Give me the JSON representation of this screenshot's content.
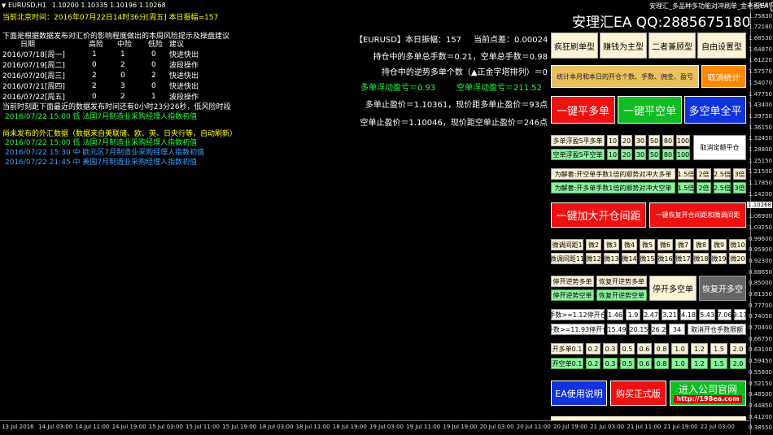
{
  "chart_header": {
    "symbol_tf": "EURUSD,H1",
    "prices": "1.10200 1.10335 1.10196 1.10268"
  },
  "ea_badge": "安理汇_多品种多功能对冲刷单_金老板EA",
  "beijing_time": "当前北京时间：2016年07月22日14时36分[周五] 本日振幅=157",
  "risk_title": "下面是根据数据发布对汇价的影响程度做出的本周风险提示及操盘建议",
  "risk_headers": [
    "日期",
    "高险",
    "中险",
    "低险",
    "建议"
  ],
  "risk_rows": [
    [
      "2016/07/18[周一]",
      "1",
      "1",
      "0",
      "快进快出"
    ],
    [
      "2016/07/19[周二]",
      "0",
      "2",
      "0",
      "波段操作"
    ],
    [
      "2016/07/20[周三]",
      "2",
      "0",
      "2",
      "快进快出"
    ],
    [
      "2016/07/21[周四]",
      "2",
      "3",
      "0",
      "快进快出"
    ],
    [
      "2016/07/22[周五]",
      "0",
      "2",
      "1",
      "波段操作"
    ]
  ],
  "countdown": "当前时刻距下面最近的数据发布时间还有0小时23分26秒，低风险时段",
  "next_release": "2016/07/22 15:00 低 法国7月制造业采购经理人指数初值",
  "upcoming_title": "尚未发布的外汇数据（数据来自美联储、欧、英、日央行等，自动刷新）",
  "upcoming": [
    "2016/07/22 15:00 低 法国7月制造业采购经理人指数初值",
    "2016/07/22 15:30 中 欧元区7月制造业采购经理人指数初值",
    "2016/07/22 21:45 中 美国7月制造业采购经理人指数初值"
  ],
  "brand": "安理汇EA QQ:2885675180",
  "stats": {
    "amplitude": "【EURUSD】本日振幅：157",
    "spread": "当前点差：0.00024",
    "lots": "持仓中的多单总手数＝0.21，空单总手数＝0.98",
    "reverse": "持仓中的逆势多单个数（▲正金字塔排列）＝0",
    "buy_float": "多单浮动盈亏＝0.93",
    "sell_float": "空单浮动盈亏＝211.52",
    "buy_tp": "多单止盈价＝1.10361，现价距多单止盈价＝93点",
    "sell_tp": "空单止盈价＝1.10046，现价距空单止盈价＝246点"
  },
  "mode_buttons": [
    "疯狂刷单型",
    "赚钱为主型",
    "二者兼顾型",
    "自由设置型"
  ],
  "stat_button": "统计本月和本日的开仓个数、手数、佣金、盈亏",
  "cancel_stat": "取消统计",
  "close_buy": "一键平多单",
  "close_sell": "一键平空单",
  "close_all": "多空单全平",
  "buy_float_close_label": "多单浮盈5平多单",
  "sell_float_close_label": "空单浮盈5平空单",
  "float_values": [
    "10",
    "20",
    "30",
    "50",
    "80",
    "100"
  ],
  "cancel_float": "取消定额平仓",
  "unlock_buy": "为解套:开空单手数1倍的顺势对冲大多单",
  "unlock_sell": "为解套:开多单手数1倍的顺势对冲大空单",
  "multipliers": [
    "1.5倍",
    "2倍",
    "2.5倍",
    "3倍"
  ],
  "widen_gap": "一键加大开仓间距",
  "restore_gap": "一键恢复开仓间距和微调间距",
  "adjust_row1": [
    "微调间距1",
    "微2",
    "微3",
    "微4",
    "微5",
    "微6",
    "微7",
    "微8",
    "微9",
    "微10"
  ],
  "adjust_row2": [
    "微调间距11",
    "微12",
    "微13",
    "微14",
    "微15",
    "微16",
    "微17",
    "微18",
    "微19",
    "微20"
  ],
  "stop_reverse_buy": "停开逆势多单",
  "resume_reverse_buy": "恢复开逆势多单",
  "stop_reverse_sell": "停开逆势空单",
  "resume_reverse_sell": "恢复开逆势空单",
  "stop_hedge": "停开多空单",
  "resume_hedge": "恢复开多空",
  "lots_row1_label": "手数>=1.12停开仓",
  "lots_row1_values": [
    "1.46",
    "1.9",
    "2.47",
    "3.21",
    "4.18",
    "5.43",
    "7.06",
    "9.17"
  ],
  "lots_row2_label": "手数>=11.93停开仓",
  "lots_row2_values": [
    "15.49",
    "20.15",
    "26.2",
    "34"
  ],
  "cancel_lots_limit": "取消开仓手数限额",
  "open_buy_label": "开多单0.1",
  "open_sell_label": "开空单0.1",
  "open_values": [
    "0.2",
    "0.3",
    "0.5",
    "0.6",
    "0.8",
    "1.0",
    "1.2",
    "1.5",
    "2.0"
  ],
  "help_button": "EA使用说明",
  "buy_button": "购买正式版",
  "website_button": "进入公司官网",
  "website_url": "http://198ea.com",
  "price_ticks": [
    "1.79480",
    "1.75830",
    "1.72180",
    "1.68530",
    "1.64870",
    "1.61220",
    "1.57570",
    "1.54070",
    "1.47750",
    "1.43400",
    "1.39750",
    "1.36150",
    "1.32450",
    "1.28800",
    "1.25150",
    "1.21500",
    "1.17850",
    "1.14200",
    "1.10268",
    "1.06900",
    "1.03250",
    "0.99600",
    "0.95900",
    "0.92300",
    "0.88650",
    "0.85000",
    "0.81350",
    "0.77700",
    "0.74050",
    "0.70400",
    "0.66750",
    "0.63100",
    "0.59450",
    "0.55800",
    "0.52150",
    "0.48500",
    "0.44850",
    "0.41200",
    "0.38550"
  ],
  "current_price": "1.10268",
  "time_ticks": [
    "13 Jul 2016",
    "14 Jul 03:00",
    "14 Jul 11:00",
    "14 Jul 19:00",
    "15 Jul 03:00",
    "15 Jul 11:00",
    "15 Jul 19:00",
    "18 Jul 03:00",
    "18 Jul 11:00",
    "18 Jul 19:00",
    "19 Jul 03:00",
    "19 Jul 11:00",
    "19 Jul 19:00",
    "20 Jul 03:00",
    "20 Jul 11:00",
    "20 Jul 19:00",
    "21 Jul 03:00",
    "21 Jul 11:00",
    "21 Jul 19:00",
    "22 Jul 03:00"
  ]
}
